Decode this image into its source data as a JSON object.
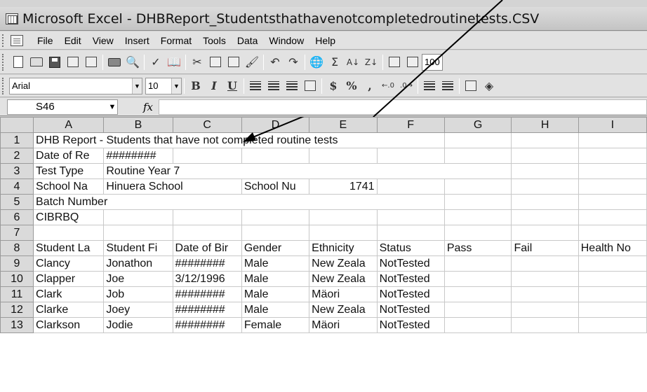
{
  "window": {
    "title": "Microsoft Excel - DHBReport_Studentsthathavenotcompletedroutinetests.CSV"
  },
  "menubar": {
    "items": [
      {
        "label": "File",
        "key": "file"
      },
      {
        "label": "Edit",
        "key": "edit"
      },
      {
        "label": "View",
        "key": "view"
      },
      {
        "label": "Insert",
        "key": "insert"
      },
      {
        "label": "Format",
        "key": "format"
      },
      {
        "label": "Tools",
        "key": "tools"
      },
      {
        "label": "Data",
        "key": "data"
      },
      {
        "label": "Window",
        "key": "window"
      },
      {
        "label": "Help",
        "key": "help"
      }
    ]
  },
  "toolbar": {
    "zoom": "100",
    "sigma": "Σ",
    "sort_asc": "A↓",
    "sort_desc": "Z↓"
  },
  "formatting": {
    "font": "Arial",
    "size": "10",
    "bold": "B",
    "italic": "I",
    "underline": "U",
    "currency": "$",
    "percent": "%",
    "comma": ","
  },
  "formula_bar": {
    "name_box": "S46",
    "fx": "fx",
    "value": ""
  },
  "sheet": {
    "columns": [
      "A",
      "B",
      "C",
      "D",
      "E",
      "F",
      "G",
      "H",
      "I"
    ],
    "rows": [
      {
        "num": "1",
        "cells": [
          "DHB Report - Students that have not completed routine tests",
          "",
          "",
          "",
          "",
          "",
          "",
          "",
          ""
        ]
      },
      {
        "num": "2",
        "cells": [
          "Date of Re",
          "########",
          "",
          "",
          "",
          "",
          "",
          "",
          ""
        ]
      },
      {
        "num": "3",
        "cells": [
          "Test Type",
          "Routine Year 7",
          "",
          "",
          "",
          "",
          "",
          "",
          ""
        ]
      },
      {
        "num": "4",
        "cells": [
          "School Na",
          "Hinuera School",
          "",
          "School Nu",
          "1741",
          "",
          "",
          "",
          ""
        ]
      },
      {
        "num": "5",
        "cells": [
          "Batch Number",
          "",
          "",
          "",
          "",
          "",
          "",
          "",
          ""
        ]
      },
      {
        "num": "6",
        "cells": [
          "CIBRBQ",
          "",
          "",
          "",
          "",
          "",
          "",
          "",
          ""
        ]
      },
      {
        "num": "7",
        "cells": [
          "",
          "",
          "",
          "",
          "",
          "",
          "",
          "",
          ""
        ]
      },
      {
        "num": "8",
        "cells": [
          "Student La",
          "Student Fi",
          "Date of Bir",
          "Gender",
          "Ethnicity",
          "Status",
          "Pass",
          "Fail",
          "Health No"
        ]
      },
      {
        "num": "9",
        "cells": [
          "Clancy",
          "Jonathon",
          "########",
          "Male",
          "New Zeala",
          "NotTested",
          "",
          "",
          ""
        ]
      },
      {
        "num": "10",
        "cells": [
          "Clapper",
          "Joe",
          "3/12/1996",
          "Male",
          "New Zeala",
          "NotTested",
          "",
          "",
          ""
        ]
      },
      {
        "num": "11",
        "cells": [
          "Clark",
          "Job",
          "########",
          "Male",
          "Mäori",
          "NotTested",
          "",
          "",
          ""
        ]
      },
      {
        "num": "12",
        "cells": [
          "Clarke",
          "Joey",
          "########",
          "Male",
          "New Zeala",
          "NotTested",
          "",
          "",
          ""
        ]
      },
      {
        "num": "13",
        "cells": [
          "Clarkson",
          "Jodie",
          "########",
          "Female",
          "Mäori",
          "NotTested",
          "",
          "",
          ""
        ]
      }
    ]
  }
}
